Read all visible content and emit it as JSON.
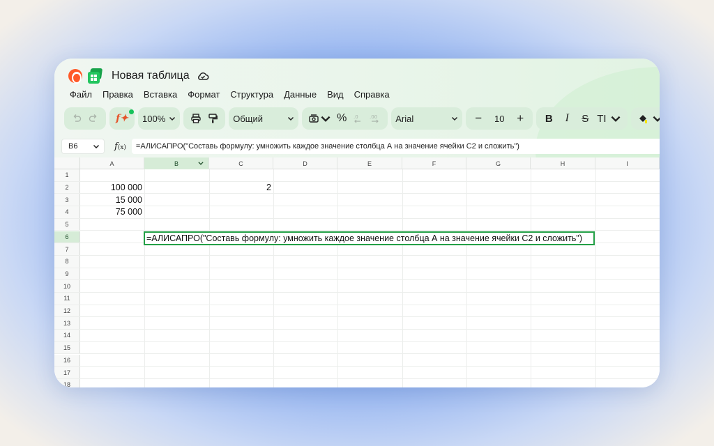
{
  "app": {
    "title": "Новая таблица",
    "colors": {
      "accent_green": "#23a046",
      "toolbar_bg": "#d9eddb",
      "alice_orange": "#ff5a28"
    }
  },
  "menu": {
    "items": [
      "Файл",
      "Правка",
      "Вставка",
      "Формат",
      "Структура",
      "Данные",
      "Вид",
      "Справка"
    ]
  },
  "toolbar": {
    "zoom": "100%",
    "number_format": "Общий",
    "percent": "%",
    "font": "Arial",
    "font_size": "10",
    "minus": "−",
    "plus": "+",
    "bold": "B",
    "italic": "I",
    "strike": "S",
    "text_size": "TI",
    "fx": "f"
  },
  "formula_bar": {
    "cell_ref": "B6",
    "fx_label": "f",
    "fx_sub": "(x)",
    "content": "=АЛИСАПРО(\"Составь формулу: умножить каждое значение столбца А на значение ячейки С2 и сложить\")"
  },
  "columns": [
    "A",
    "B",
    "C",
    "D",
    "E",
    "F",
    "G",
    "H",
    "I"
  ],
  "selected_column": "B",
  "rows": [
    "1",
    "2",
    "3",
    "4",
    "5",
    "6",
    "7",
    "8",
    "9",
    "10",
    "11",
    "12",
    "13",
    "14",
    "15",
    "16",
    "17",
    "18"
  ],
  "selected_row": "6",
  "cells": {
    "A2": "100 000",
    "A3": "15 000",
    "A4": "75 000",
    "C2": "2"
  },
  "editing_cell": {
    "ref": "B6",
    "content": "=АЛИСАПРО(\"Составь формулу: умножить каждое значение столбца А на значение ячейки С2 и сложить\")"
  }
}
